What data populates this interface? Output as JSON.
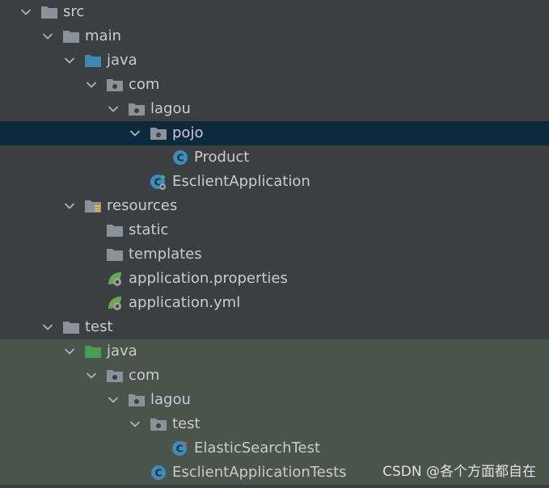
{
  "tree": [
    {
      "name": "src",
      "depth": 0,
      "expanded": true,
      "icon": "folder-icon",
      "bg": "none"
    },
    {
      "name": "main",
      "depth": 1,
      "expanded": true,
      "icon": "folder-icon",
      "bg": "none"
    },
    {
      "name": "java",
      "depth": 2,
      "expanded": true,
      "icon": "source-folder-icon",
      "bg": "none"
    },
    {
      "name": "com",
      "depth": 3,
      "expanded": true,
      "icon": "package-icon",
      "bg": "none"
    },
    {
      "name": "lagou",
      "depth": 4,
      "expanded": true,
      "icon": "package-icon",
      "bg": "none"
    },
    {
      "name": "pojo",
      "depth": 5,
      "expanded": true,
      "icon": "package-icon",
      "bg": "selected"
    },
    {
      "name": "Product",
      "depth": 6,
      "expanded": null,
      "icon": "class-icon",
      "bg": "none"
    },
    {
      "name": "EsclientApplication",
      "depth": 5,
      "expanded": null,
      "icon": "spring-class-icon",
      "bg": "none"
    },
    {
      "name": "resources",
      "depth": 2,
      "expanded": true,
      "icon": "resources-folder-icon",
      "bg": "none"
    },
    {
      "name": "static",
      "depth": 3,
      "expanded": null,
      "icon": "folder-icon",
      "bg": "none"
    },
    {
      "name": "templates",
      "depth": 3,
      "expanded": null,
      "icon": "folder-icon",
      "bg": "none"
    },
    {
      "name": "application.properties",
      "depth": 3,
      "expanded": null,
      "icon": "spring-config-icon",
      "bg": "none"
    },
    {
      "name": "application.yml",
      "depth": 3,
      "expanded": null,
      "icon": "spring-config-icon",
      "bg": "none"
    },
    {
      "name": "test",
      "depth": 1,
      "expanded": true,
      "icon": "folder-icon",
      "bg": "none"
    },
    {
      "name": "java",
      "depth": 2,
      "expanded": true,
      "icon": "test-source-folder-icon",
      "bg": "test"
    },
    {
      "name": "com",
      "depth": 3,
      "expanded": true,
      "icon": "package-icon",
      "bg": "test"
    },
    {
      "name": "lagou",
      "depth": 4,
      "expanded": true,
      "icon": "package-icon",
      "bg": "test"
    },
    {
      "name": "test",
      "depth": 5,
      "expanded": true,
      "icon": "package-icon",
      "bg": "test"
    },
    {
      "name": "ElasticSearchTest",
      "depth": 6,
      "expanded": null,
      "icon": "test-class-icon",
      "bg": "test"
    },
    {
      "name": "EsclientApplicationTests",
      "depth": 5,
      "expanded": null,
      "icon": "class-icon",
      "bg": "test"
    }
  ],
  "watermark": "CSDN @各个方面都自在",
  "colors": {
    "background": "#3c3f41",
    "selected": "#0d293e",
    "test_root": "#49544a",
    "text": "#c8cbcf",
    "folder": "#8a9199",
    "source_folder": "#3f88b4",
    "test_folder": "#499c54",
    "class": "#3d8dbb",
    "spring": "#6aa84f"
  }
}
